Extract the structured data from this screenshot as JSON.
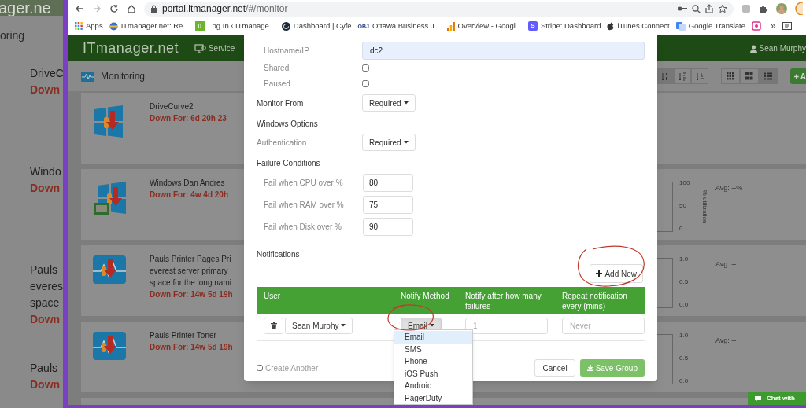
{
  "background_window": {
    "logo": "ager.ne",
    "page_title": "oring",
    "cards": [
      {
        "lines": [
          "DriveC"
        ],
        "status": "Down"
      },
      {
        "lines": [
          "Windo"
        ],
        "status": "Down"
      },
      {
        "lines": [
          "Pauls",
          "everes",
          "space"
        ],
        "status": "Down"
      },
      {
        "lines": [
          "Pauls"
        ],
        "status": "Down"
      }
    ]
  },
  "browser": {
    "url_host": "portal.itmanager.net",
    "url_path": "/#/monitor",
    "overflow": "»",
    "bookmarks": [
      {
        "label": "Apps",
        "kind": "apps"
      },
      {
        "label": "ITmanager.net: Re...",
        "kind": "globe"
      },
      {
        "label": "Log In ‹ ITmanage...",
        "kind": "badge",
        "icon_text": "IT"
      },
      {
        "label": "Dashboard | Cyfe",
        "kind": "dark"
      },
      {
        "label": "Ottawa Business J...",
        "kind": "letters",
        "icon_text": "OBJ"
      },
      {
        "label": "Overview - Googl...",
        "kind": "bars"
      },
      {
        "label": "Stripe: Dashboard",
        "kind": "badge2",
        "icon_text": "S"
      },
      {
        "label": "iTunes Connect",
        "kind": "apple"
      },
      {
        "label": "Google Translate",
        "kind": "translate"
      }
    ]
  },
  "app": {
    "logo": "ITmanager.net",
    "nav": [
      {
        "label": "Service"
      }
    ],
    "user": "Sean Murphy",
    "page_title": "Monitoring",
    "add_label": "A",
    "sort_buttons": [
      {
        "kind": "sort-num",
        "selected": true
      },
      {
        "kind": "sort-alpha",
        "selected": false
      },
      {
        "kind": "sort-list",
        "selected": false
      }
    ],
    "view_buttons": [
      {
        "kind": "grid-small",
        "selected": false
      },
      {
        "kind": "grid-large",
        "selected": false
      },
      {
        "kind": "list",
        "selected": true
      }
    ],
    "monitors": [
      {
        "kind": "windows",
        "name_lines": [
          "DriveCurve2"
        ],
        "status": "Down For: 6d 20h 23"
      },
      {
        "kind": "windows-vm",
        "name_lines": [
          "Windows Dan Andres"
        ],
        "status": "Down For: 4w 4d 20h",
        "chart": {
          "ticks": [
            "100",
            "50",
            "0"
          ],
          "axis_label": "% utilization",
          "avg": "Avg: --%"
        }
      },
      {
        "kind": "printer",
        "name_lines": [
          "Pauls Printer Pages Pri",
          "everest server primary",
          "space for the long nami"
        ],
        "status": "Down For: 14w 5d 19h",
        "chart": {
          "ticks": [
            "1.0",
            "0.5",
            "0.0"
          ],
          "avg": "Avg: --"
        }
      },
      {
        "kind": "printer",
        "name_lines": [
          "Pauls Printer Toner"
        ],
        "status": "Down For: 14w 5d 19h",
        "chart": {
          "ticks": [
            "1.0",
            "0.5",
            "0.0"
          ],
          "avg": "Avg: --"
        }
      }
    ]
  },
  "modal": {
    "fields": [
      {
        "kind": "text",
        "label": "Hostname/IP",
        "value": "dc2"
      },
      {
        "kind": "checkbox",
        "label": "Shared",
        "checked": false
      },
      {
        "kind": "checkbox",
        "label": "Paused",
        "checked": false
      },
      {
        "kind": "section-select",
        "label": "Monitor From",
        "value": "Required"
      },
      {
        "kind": "heading",
        "label": "Windows Options"
      },
      {
        "kind": "select",
        "label": "Authentication",
        "value": "Required"
      },
      {
        "kind": "heading",
        "label": "Failure Conditions"
      },
      {
        "kind": "number",
        "label": "Fail when CPU over %",
        "value": "80"
      },
      {
        "kind": "number",
        "label": "Fail when RAM over %",
        "value": "75"
      },
      {
        "kind": "number",
        "label": "Fail when Disk over %",
        "value": "90"
      },
      {
        "kind": "heading",
        "label": "Notifications"
      }
    ],
    "add_button": "Add New",
    "table": {
      "columns": [
        "User",
        "Notify Method",
        "Notify after how many failures",
        "Repeat notification every (mins)"
      ],
      "rows": [
        {
          "user": "Sean Murphy",
          "method": "Email",
          "method_expanded": true,
          "failures_placeholder": "1",
          "repeat_placeholder": "Never"
        }
      ]
    },
    "method_menu": [
      {
        "label": "Email",
        "selected": true
      },
      {
        "label": "SMS",
        "selected": false
      },
      {
        "label": "Phone",
        "selected": false
      },
      {
        "label": "iOS Push",
        "selected": false
      },
      {
        "label": "Android",
        "selected": false
      },
      {
        "label": "PagerDuty",
        "selected": false
      }
    ],
    "create_another": {
      "label": "Create Another",
      "checked": false
    },
    "buttons": [
      {
        "label": "Cancel",
        "kind": "default"
      },
      {
        "label": "Save Group",
        "kind": "primary"
      }
    ]
  },
  "chat": "Chat with"
}
